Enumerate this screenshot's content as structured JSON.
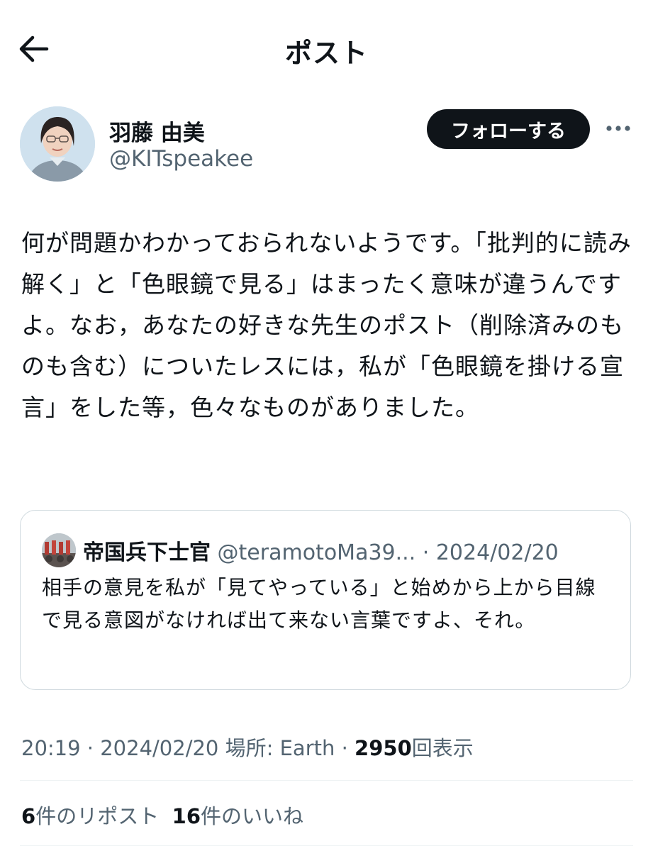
{
  "header": {
    "title": "ポスト",
    "back_icon": "arrow-left-icon"
  },
  "author": {
    "display_name": "羽藤 由美",
    "handle": "@KITspeakee",
    "follow_label": "フォローする",
    "more_icon": "more-horizontal-icon"
  },
  "post": {
    "text": "何が問題かわかっておられないようです。「批判的に読み解く」と「色眼鏡で見る」はまったく意味が違うんですよ。なお，あなたの好きな先生のポスト（削除済みのものも含む）についたレスには，私が「色眼鏡を掛ける宣言」をした等，色々なものがありました。"
  },
  "quote": {
    "name": "帝国兵下士官",
    "handle": "@teramotoMa39...",
    "sep": " · ",
    "date": "2024/02/20",
    "text": "相手の意見を私が「見てやっている」と始めから上から目線で見る意図がなければ出て来ない言葉ですよ、それ。"
  },
  "meta": {
    "time": "20:19",
    "sep1": " · ",
    "date": "2024/02/20",
    "location": " 場所: Earth",
    "sep2": " · ",
    "views": "2950",
    "views_label": "回表示"
  },
  "stats": {
    "reposts": "6",
    "reposts_label": "件のリポスト",
    "likes": "16",
    "likes_label": "件のいいね"
  },
  "colors": {
    "text": "#0f1419",
    "secondary": "#536471",
    "border": "#cfd9de",
    "button": "#0f1419"
  }
}
